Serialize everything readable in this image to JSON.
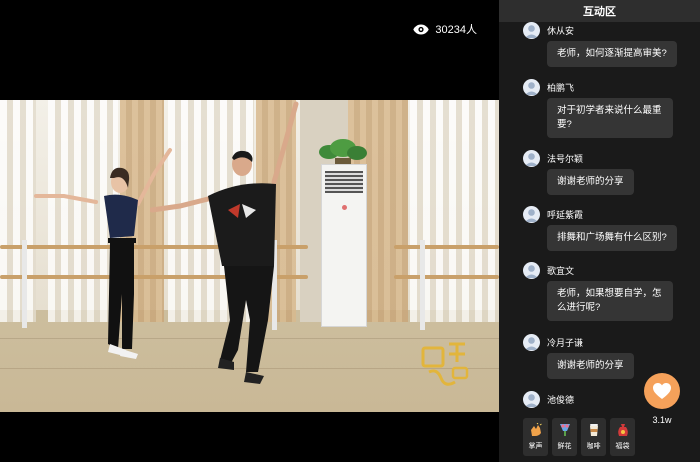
{
  "video": {
    "viewer_count": "30234人"
  },
  "chat": {
    "title": "互动区",
    "messages": [
      {
        "user": "休从安",
        "text": "老师，如何逐渐提高审美?"
      },
      {
        "user": "柏鹏飞",
        "text": "对于初学者来说什么最重要?"
      },
      {
        "user": "法号尔颖",
        "text": "谢谢老师的分享"
      },
      {
        "user": "呼延紫霞",
        "text": "排舞和广场舞有什么区别?"
      },
      {
        "user": "歌宜文",
        "text": "老师，如果想要自学，怎么进行呢?"
      },
      {
        "user": "冷月子谦",
        "text": "谢谢老师的分享"
      },
      {
        "user": "池俊德",
        "text": ""
      }
    ],
    "like_count": "3.1w",
    "gifts": [
      {
        "label": "掌声",
        "icon": "clap-icon"
      },
      {
        "label": "鲜花",
        "icon": "flower-icon"
      },
      {
        "label": "咖啡",
        "icon": "coffee-icon"
      },
      {
        "label": "福袋",
        "icon": "lucky-bag-icon"
      }
    ]
  },
  "colors": {
    "like_button": "#f5a15a",
    "panel_bg": "#1a1a1a",
    "bubble_bg": "#353535"
  }
}
